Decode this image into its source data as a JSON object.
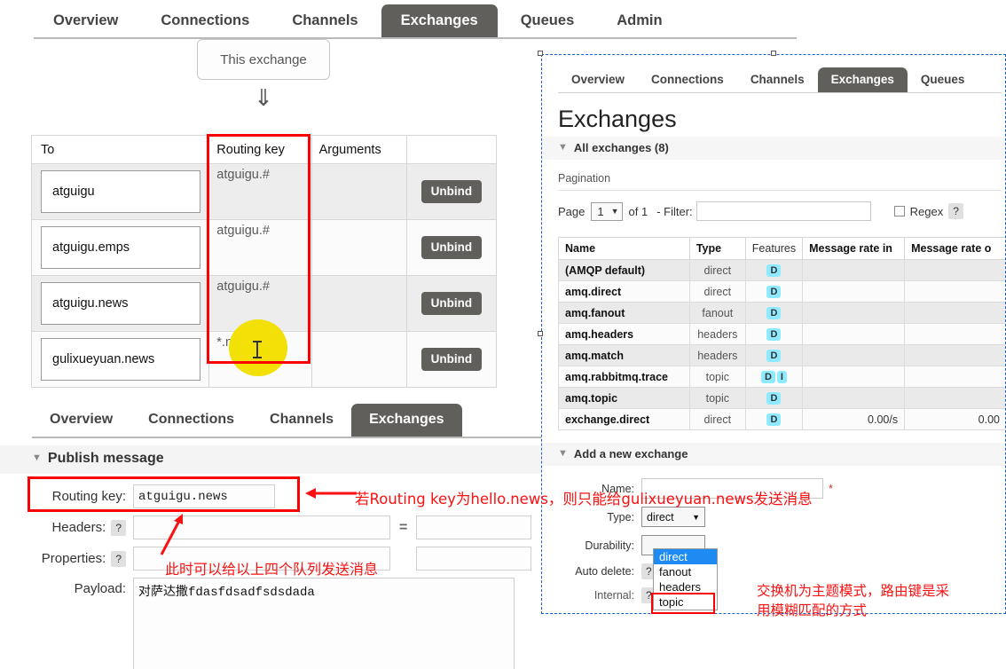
{
  "colors": {
    "active_tab_bg": "#605f5c",
    "annotation_red": "#fb1111",
    "highlight_yellow": "#f2e007",
    "badge_cyan": "#8eeaff",
    "select_blue": "#1d8bf1",
    "inset_border_blue": "#1a5fd0"
  },
  "top_panel": {
    "nav": [
      {
        "label": "Overview",
        "active": false
      },
      {
        "label": "Connections",
        "active": false
      },
      {
        "label": "Channels",
        "active": false
      },
      {
        "label": "Exchanges",
        "active": true
      },
      {
        "label": "Queues",
        "active": false
      },
      {
        "label": "Admin",
        "active": false
      }
    ],
    "this_exchange_label": "This exchange",
    "arrow_glyph": "⇓",
    "bindings_table": {
      "columns": [
        "To",
        "Routing key",
        "Arguments",
        ""
      ],
      "rows": [
        {
          "to": "atguigu",
          "routing_key": "atguigu.#",
          "arguments": "",
          "action": "Unbind"
        },
        {
          "to": "atguigu.emps",
          "routing_key": "atguigu.#",
          "arguments": "",
          "action": "Unbind"
        },
        {
          "to": "atguigu.news",
          "routing_key": "atguigu.#",
          "arguments": "",
          "action": "Unbind"
        },
        {
          "to": "gulixueyuan.news",
          "routing_key": "*.news",
          "arguments": "",
          "action": "Unbind"
        }
      ]
    }
  },
  "bottom_panel": {
    "nav": [
      {
        "label": "Overview",
        "active": false
      },
      {
        "label": "Connections",
        "active": false
      },
      {
        "label": "Channels",
        "active": false
      },
      {
        "label": "Exchanges",
        "active": true
      }
    ],
    "section_title": "Publish message",
    "fields": {
      "routing_key_label": "Routing key:",
      "routing_key_value": "atguigu.news",
      "headers_label": "Headers:",
      "headers_value": "",
      "headers_eq": "=",
      "headers_value2": "",
      "properties_label": "Properties:",
      "properties_value": "",
      "payload_label": "Payload:",
      "payload_value": "对萨达撒fdasfdsadfsdsdada",
      "help_glyph": "?"
    }
  },
  "right_panel": {
    "nav": [
      {
        "label": "Overview",
        "active": false
      },
      {
        "label": "Connections",
        "active": false
      },
      {
        "label": "Channels",
        "active": false
      },
      {
        "label": "Exchanges",
        "active": true
      },
      {
        "label": "Queues",
        "active": false
      }
    ],
    "page_title": "Exchanges",
    "all_exchanges_label": "All exchanges (8)",
    "pagination_label": "Pagination",
    "pagination": {
      "page_word": "Page",
      "page_value": "1",
      "of_text": "of 1",
      "filter_label": "- Filter:",
      "filter_value": "",
      "regex_label": "Regex",
      "help_glyph": "?"
    },
    "exchanges_table": {
      "columns": [
        "Name",
        "Type",
        "Features",
        "Message rate in",
        "Message rate o"
      ],
      "rows": [
        {
          "name": "(AMQP default)",
          "type": "direct",
          "features": [
            "D"
          ],
          "rate_in": "",
          "rate_out": ""
        },
        {
          "name": "amq.direct",
          "type": "direct",
          "features": [
            "D"
          ],
          "rate_in": "",
          "rate_out": ""
        },
        {
          "name": "amq.fanout",
          "type": "fanout",
          "features": [
            "D"
          ],
          "rate_in": "",
          "rate_out": ""
        },
        {
          "name": "amq.headers",
          "type": "headers",
          "features": [
            "D"
          ],
          "rate_in": "",
          "rate_out": ""
        },
        {
          "name": "amq.match",
          "type": "headers",
          "features": [
            "D"
          ],
          "rate_in": "",
          "rate_out": ""
        },
        {
          "name": "amq.rabbitmq.trace",
          "type": "topic",
          "features": [
            "D",
            "I"
          ],
          "rate_in": "",
          "rate_out": ""
        },
        {
          "name": "amq.topic",
          "type": "topic",
          "features": [
            "D"
          ],
          "rate_in": "",
          "rate_out": ""
        },
        {
          "name": "exchange.direct",
          "type": "direct",
          "features": [
            "D"
          ],
          "rate_in": "0.00/s",
          "rate_out": "0.00"
        }
      ]
    },
    "add_exchange": {
      "section_title": "Add a new exchange",
      "name_label": "Name:",
      "name_value": "",
      "required_marker": "*",
      "type_label": "Type:",
      "type_value": "direct",
      "type_options": [
        "direct",
        "fanout",
        "headers",
        "topic"
      ],
      "type_selected_option": "direct",
      "type_boxed_option": "topic",
      "durability_label": "Durability:",
      "auto_delete_label": "Auto delete:",
      "internal_label": "Internal:",
      "help_glyph": "?"
    }
  },
  "annotations": [
    {
      "id": "ann1",
      "text": "若Routing key为hello.news，则只能给gulixueyuan.news发送消息"
    },
    {
      "id": "ann2",
      "text": "此时可以给以上四个队列发送消息"
    },
    {
      "id": "ann3",
      "text": "交换机为主题模式，路由键是采用模糊匹配的方式"
    }
  ]
}
